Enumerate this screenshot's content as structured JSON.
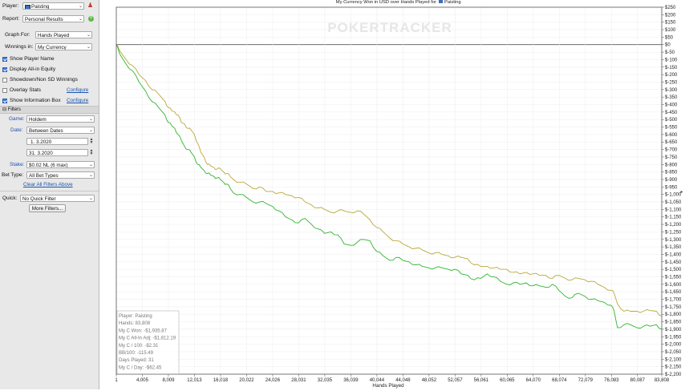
{
  "sidebar": {
    "player_label": "Player:",
    "player_value": "Paisting",
    "report_label": "Report:",
    "report_value": "Personal Results",
    "graph_for_label": "Graph For:",
    "graph_for_value": "Hands Played",
    "winnings_in_label": "Winnings in:",
    "winnings_in_value": "My Currency",
    "checkboxes": [
      {
        "label": "Show Player Name",
        "checked": true
      },
      {
        "label": "Display All-in Equity",
        "checked": true
      },
      {
        "label": "Showdown/Non SD Winnings",
        "checked": false
      },
      {
        "label": "Overlay Stats",
        "checked": false
      },
      {
        "label": "Show Information Box",
        "checked": true
      }
    ],
    "configure_label": "Configure",
    "filters_header": "Filters",
    "game_label": "Game:",
    "game_value": "Holdem",
    "date_label": "Date:",
    "date_value": "Between Dates",
    "date_from": "1.  3.2020",
    "date_to": "31.  3.2020",
    "stake_label": "Stake:",
    "stake_value": "$0.02 NL (6 max)",
    "bet_type_label": "Bet Type:",
    "bet_type_value": "All Bet Types",
    "clear_filters": "Clear All Filters Above",
    "quick_label": "Quick:",
    "quick_value": "No Quick Filter",
    "more_filters": "More Filters..."
  },
  "chart_data": {
    "type": "line",
    "title_prefix": "My Currency Won in USD over Hands Played for",
    "title_player": "Paisting",
    "watermark": "POKERTRACKER",
    "xlabel": "Hands Played",
    "xlim": [
      1,
      83808
    ],
    "ylim": [
      -2200,
      250
    ],
    "x_ticks": [
      1,
      4005,
      8009,
      12013,
      16018,
      20022,
      24026,
      28031,
      32035,
      36039,
      40044,
      44048,
      48052,
      52057,
      56061,
      60065,
      64070,
      68074,
      72079,
      76083,
      80087,
      83808
    ],
    "x_tick_labels": [
      "1",
      "4,005",
      "8,009",
      "12,013",
      "16,018",
      "20,022",
      "24,026",
      "28,031",
      "32,035",
      "36,039",
      "40,044",
      "44,048",
      "48,052",
      "52,057",
      "56,061",
      "60,065",
      "64,070",
      "68,074",
      "72,079",
      "76,083",
      "80,087",
      "83,808"
    ],
    "y_ticks": [
      250,
      200,
      150,
      100,
      50,
      0,
      -50,
      -100,
      -150,
      -200,
      -250,
      -300,
      -350,
      -400,
      -450,
      -500,
      -550,
      -600,
      -650,
      -700,
      -750,
      -800,
      -850,
      -900,
      -950,
      -1000,
      -1050,
      -1100,
      -1150,
      -1200,
      -1250,
      -1300,
      -1350,
      -1400,
      -1450,
      -1500,
      -1550,
      -1600,
      -1650,
      -1700,
      -1750,
      -1800,
      -1850,
      -1900,
      -1950,
      -2000,
      -2050,
      -2100,
      -2150,
      -2200
    ],
    "y_tick_labels": [
      "$250",
      "$200",
      "$150",
      "$100",
      "$50",
      "$0",
      "$-50",
      "$-100",
      "$-150",
      "$-200",
      "$-250",
      "$-300",
      "$-350",
      "$-400",
      "$-450",
      "$-500",
      "$-550",
      "$-600",
      "$-650",
      "$-700",
      "$-750",
      "$-800",
      "$-850",
      "$-900",
      "$-950",
      "$-1,000",
      "$-1,050",
      "$-1,100",
      "$-1,150",
      "$-1,200",
      "$-1,250",
      "$-1,300",
      "$-1,350",
      "$-1,400",
      "$-1,450",
      "$-1,500",
      "$-1,550",
      "$-1,600",
      "$-1,650",
      "$-1,700",
      "$-1,750",
      "$-1,800",
      "$-1,850",
      "$-1,900",
      "$-1,950",
      "$-2,000",
      "$-2,050",
      "$-2,100",
      "$-2,150",
      "$-2,200"
    ],
    "grid": true,
    "series": [
      {
        "name": "My C Won",
        "color": "#2fb52f",
        "x": [
          1,
          500,
          1500,
          2500,
          3500,
          4500,
          5500,
          6500,
          7500,
          8000,
          8500,
          9000,
          9500,
          10000,
          10500,
          11000,
          11500,
          12000,
          12500,
          13000,
          13500,
          14000,
          14500,
          15000,
          15500,
          16000,
          16500,
          17000,
          17500,
          18000,
          19000,
          20000,
          21000,
          22000,
          23000,
          24000,
          25000,
          26000,
          27000,
          28000,
          29000,
          30000,
          31000,
          32000,
          33000,
          34000,
          35000,
          36000,
          37000,
          38000,
          39000,
          40000,
          41000,
          42000,
          43000,
          44000,
          45000,
          46000,
          47000,
          48000,
          49000,
          50000,
          51000,
          52000,
          53000,
          54000,
          55000,
          56000,
          57000,
          58000,
          59000,
          60000,
          61000,
          62000,
          63000,
          64000,
          65000,
          66000,
          67000,
          68000,
          69000,
          70000,
          71000,
          72000,
          73000,
          74000,
          75000,
          76000,
          76500,
          77000,
          78000,
          79000,
          80000,
          81000,
          82000,
          83000,
          83808
        ],
        "values": [
          0,
          -60,
          -130,
          -175,
          -250,
          -310,
          -380,
          -420,
          -470,
          -520,
          -540,
          -560,
          -600,
          -640,
          -680,
          -700,
          -720,
          -750,
          -800,
          -820,
          -840,
          -860,
          -870,
          -880,
          -890,
          -900,
          -920,
          -930,
          -960,
          -990,
          -1000,
          -1020,
          -1050,
          -1050,
          -1060,
          -1080,
          -1110,
          -1150,
          -1170,
          -1190,
          -1160,
          -1200,
          -1230,
          -1260,
          -1250,
          -1270,
          -1330,
          -1340,
          -1320,
          -1300,
          -1310,
          -1380,
          -1410,
          -1440,
          -1420,
          -1440,
          -1450,
          -1470,
          -1480,
          -1490,
          -1490,
          -1490,
          -1500,
          -1500,
          -1530,
          -1540,
          -1570,
          -1560,
          -1530,
          -1550,
          -1580,
          -1600,
          -1590,
          -1600,
          -1590,
          -1610,
          -1610,
          -1620,
          -1600,
          -1640,
          -1680,
          -1690,
          -1660,
          -1680,
          -1700,
          -1710,
          -1720,
          -1740,
          -1780,
          -1890,
          -1870,
          -1870,
          -1890,
          -1880,
          -1880,
          -1870,
          -1900
        ]
      },
      {
        "name": "My C All-In Adj",
        "color": "#b8a83a",
        "x": [
          1,
          500,
          1500,
          2500,
          3500,
          4500,
          5500,
          6500,
          7500,
          8000,
          8500,
          9000,
          9500,
          10000,
          10500,
          11000,
          11500,
          12000,
          12500,
          13000,
          13500,
          14000,
          14500,
          15000,
          15500,
          16000,
          16500,
          17000,
          17500,
          18000,
          19000,
          20000,
          21000,
          22000,
          23000,
          24000,
          25000,
          26000,
          27000,
          28000,
          29000,
          30000,
          31000,
          32000,
          33000,
          34000,
          35000,
          36000,
          37000,
          38000,
          39000,
          40000,
          41000,
          42000,
          43000,
          44000,
          45000,
          46000,
          47000,
          48000,
          49000,
          50000,
          51000,
          52000,
          53000,
          54000,
          55000,
          56000,
          57000,
          58000,
          59000,
          60000,
          61000,
          62000,
          63000,
          64000,
          65000,
          66000,
          67000,
          68000,
          69000,
          70000,
          71000,
          72000,
          73000,
          74000,
          75000,
          76000,
          76500,
          77000,
          78000,
          79000,
          80000,
          81000,
          82000,
          83000,
          83808
        ],
        "values": [
          0,
          -40,
          -100,
          -140,
          -200,
          -240,
          -300,
          -330,
          -380,
          -420,
          -440,
          -450,
          -470,
          -520,
          -530,
          -560,
          -570,
          -600,
          -660,
          -720,
          -750,
          -800,
          -810,
          -820,
          -830,
          -830,
          -850,
          -860,
          -880,
          -900,
          -920,
          -930,
          -960,
          -950,
          -980,
          -980,
          -990,
          -1000,
          -1010,
          -1020,
          -1050,
          -1070,
          -1090,
          -1100,
          -1120,
          -1110,
          -1110,
          -1120,
          -1110,
          -1130,
          -1170,
          -1220,
          -1250,
          -1290,
          -1310,
          -1330,
          -1350,
          -1360,
          -1370,
          -1390,
          -1390,
          -1400,
          -1410,
          -1420,
          -1420,
          -1430,
          -1470,
          -1480,
          -1480,
          -1490,
          -1500,
          -1500,
          -1520,
          -1530,
          -1520,
          -1530,
          -1540,
          -1540,
          -1560,
          -1540,
          -1560,
          -1570,
          -1560,
          -1570,
          -1580,
          -1600,
          -1620,
          -1640,
          -1660,
          -1730,
          -1780,
          -1780,
          -1780,
          -1780,
          -1775,
          -1780,
          -1812
        ]
      }
    ],
    "info_box": [
      "Player: Paisting",
      "Hands: 83,808",
      "My C Won: -$1,935.87",
      "My C All-In Adj: -$1,812.19",
      "My C / 100: -$2.31",
      "BB/100: -115.49",
      "Days Played: 31",
      "My C / Day: -$62.45"
    ]
  }
}
